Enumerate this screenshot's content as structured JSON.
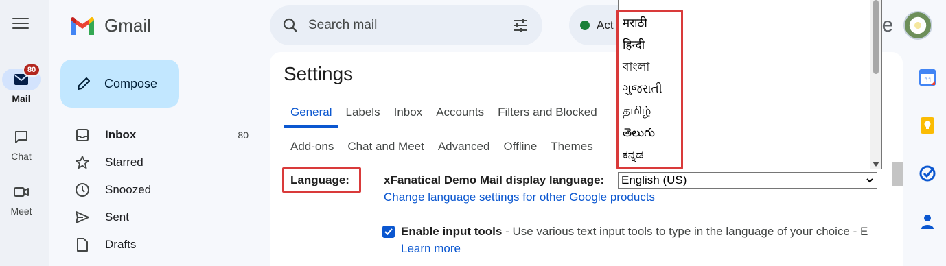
{
  "app": {
    "name": "Gmail"
  },
  "rail": {
    "items": [
      {
        "label": "Mail",
        "badge": "80",
        "icon": "mail-icon",
        "active": true
      },
      {
        "label": "Chat",
        "icon": "chat-icon"
      },
      {
        "label": "Meet",
        "icon": "meet-icon"
      }
    ]
  },
  "compose": {
    "label": "Compose"
  },
  "nav": {
    "items": [
      {
        "label": "Inbox",
        "count": "80",
        "icon": "inbox-icon"
      },
      {
        "label": "Starred",
        "icon": "star-icon"
      },
      {
        "label": "Snoozed",
        "icon": "clock-icon"
      },
      {
        "label": "Sent",
        "icon": "send-icon"
      },
      {
        "label": "Drafts",
        "icon": "draft-icon"
      }
    ]
  },
  "search": {
    "placeholder": "Search mail"
  },
  "status": {
    "label": "Act"
  },
  "topright": {
    "partial_text": "le"
  },
  "settings": {
    "title": "Settings",
    "tabs_row1": [
      "General",
      "Labels",
      "Inbox",
      "Accounts",
      "Filters and Blocked"
    ],
    "tabs_row2": [
      "Add-ons",
      "Chat and Meet",
      "Advanced",
      "Offline",
      "Themes"
    ],
    "active_tab": "General",
    "language_label": "Language:",
    "display_language_label": "xFanatical Demo Mail display language:",
    "display_language_value": "English (US)",
    "change_link": "Change language settings for other Google products",
    "enable_bold": "Enable input tools",
    "enable_rest": " - Use various text input tools to type in the language of your choice - E",
    "learn_more": "Learn more"
  },
  "dropdown": {
    "options": [
      "मराठी",
      "हिन्दी",
      "বাংলা",
      "ગુજરાતી",
      "தமிழ்",
      "తెలుగు",
      "ಕನ್ನಡ"
    ]
  },
  "colors": {
    "accent": "#0b57d0",
    "highlight": "#d93a3a",
    "compose_bg": "#c2e7ff",
    "badge": "#b3261e"
  }
}
